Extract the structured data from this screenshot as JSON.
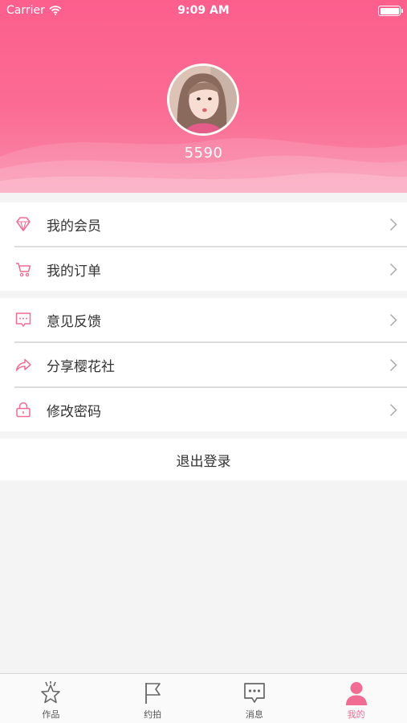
{
  "status_bar": {
    "carrier": "Carrier",
    "time": "9:09 AM"
  },
  "profile": {
    "username": "5590"
  },
  "menu_group1": [
    {
      "label": "我的会员",
      "icon": "diamond-icon"
    },
    {
      "label": "我的订单",
      "icon": "cart-icon"
    }
  ],
  "menu_group2": [
    {
      "label": "意见反馈",
      "icon": "feedback-icon"
    },
    {
      "label": "分享樱花社",
      "icon": "share-icon"
    },
    {
      "label": "修改密码",
      "icon": "lock-icon"
    }
  ],
  "logout_label": "退出登录",
  "tabbar": [
    {
      "label": "作品",
      "icon": "star-icon",
      "active": false
    },
    {
      "label": "约拍",
      "icon": "flag-icon",
      "active": false
    },
    {
      "label": "消息",
      "icon": "message-icon",
      "active": false
    },
    {
      "label": "我的",
      "icon": "person-icon",
      "active": true
    }
  ],
  "colors": {
    "header": "#fd5f8d",
    "accent": "#f06c92",
    "background": "#f4f4f5"
  }
}
